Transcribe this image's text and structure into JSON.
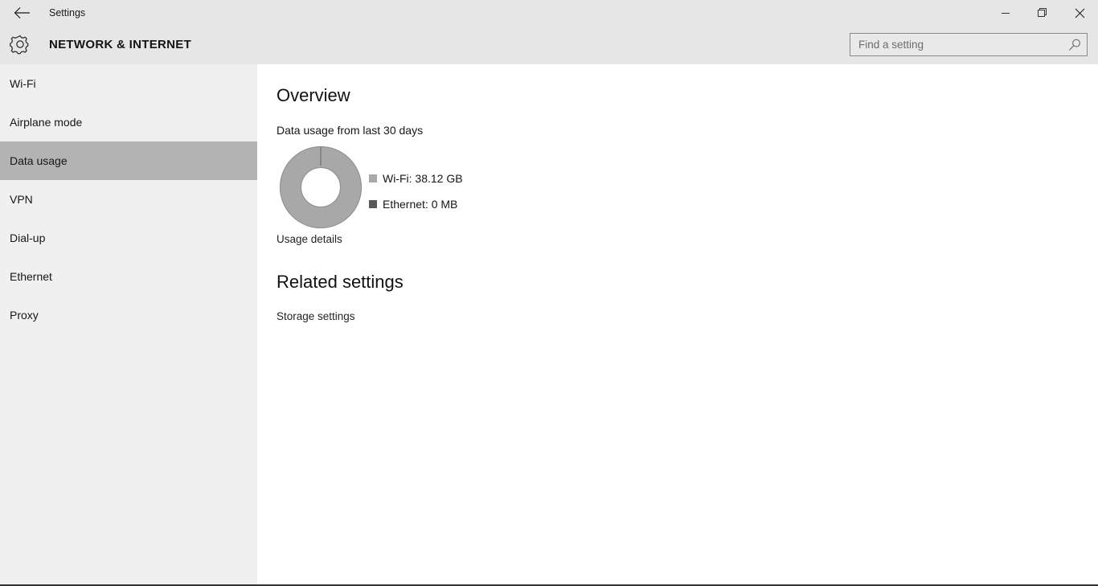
{
  "window": {
    "title": "Settings",
    "back_icon": "back-arrow-icon",
    "minimize_label": "Minimize",
    "restore_label": "Restore",
    "close_label": "Close"
  },
  "header": {
    "gear_icon": "gear-icon",
    "page_title": "NETWORK & INTERNET"
  },
  "search": {
    "placeholder": "Find a setting",
    "value": "",
    "icon": "search-icon"
  },
  "sidebar": {
    "selected": "Data usage",
    "items": [
      {
        "label": "Wi-Fi",
        "selected": false
      },
      {
        "label": "Airplane mode",
        "selected": false
      },
      {
        "label": "Data usage",
        "selected": true
      },
      {
        "label": "VPN",
        "selected": false
      },
      {
        "label": "Dial-up",
        "selected": false
      },
      {
        "label": "Ethernet",
        "selected": false
      },
      {
        "label": "Proxy",
        "selected": false
      }
    ]
  },
  "main": {
    "overview_heading": "Overview",
    "usage_subtitle": "Data usage from last 30 days",
    "usage_details_link": "Usage details",
    "related_heading": "Related settings",
    "storage_settings_link": "Storage settings"
  },
  "chart_data": {
    "type": "pie",
    "variant": "donut",
    "title": "Data usage from last 30 days",
    "labels": [
      "Wi-Fi",
      "Ethernet"
    ],
    "legend_entries": [
      "Wi-Fi: 38.12 GB",
      "Ethernet: 0 MB"
    ],
    "values": [
      38.12,
      0
    ],
    "units": [
      "GB",
      "MB"
    ],
    "value_texts": [
      "38.12 GB",
      "0 MB"
    ],
    "percentages": [
      100,
      0
    ],
    "colors": [
      "#a8a8a8",
      "#595959"
    ],
    "legend_position": "right",
    "start_angle_deg": 0,
    "hole_ratio": 0.55
  },
  "colors": {
    "titlebar_bg": "#e6e6e6",
    "sidebar_bg": "#f0f0f0",
    "content_bg": "#ffffff",
    "selected_item_bg": "#b3b3b3",
    "wifi_series": "#a8a8a8",
    "ethernet_series": "#595959",
    "text_primary": "#161616"
  }
}
